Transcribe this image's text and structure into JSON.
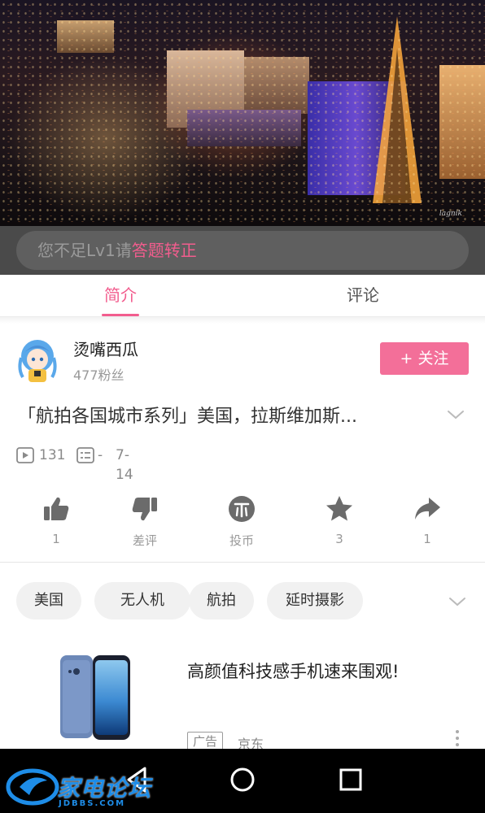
{
  "video": {
    "signature": "lagnik"
  },
  "danmaku": {
    "prefix": "您不足Lv1请",
    "link": "答题转正"
  },
  "tabs": [
    {
      "label": "简介",
      "active": true
    },
    {
      "label": "评论",
      "active": false
    }
  ],
  "uploader": {
    "name": "烫嘴西瓜",
    "fans": "477粉丝",
    "follow_label": "+ 关注"
  },
  "video_info": {
    "title": "「航拍各国城市系列」美国，拉斯维加斯...",
    "views": "131",
    "danmaku_count": "-",
    "date": "7-14"
  },
  "actions": [
    {
      "icon": "thumbs-up-icon",
      "label": "1"
    },
    {
      "icon": "thumbs-down-icon",
      "label": "差评"
    },
    {
      "icon": "coin-icon",
      "label": "投币"
    },
    {
      "icon": "star-icon",
      "label": "3"
    },
    {
      "icon": "share-icon",
      "label": "1"
    }
  ],
  "tags": [
    "美国",
    "无人机",
    "航拍",
    "延时摄影"
  ],
  "ad": {
    "title": "高颜值科技感手机速来围观!",
    "badge": "广告",
    "source": "京东"
  },
  "watermark": {
    "text": "家电论坛",
    "sub": "JDBBS.COM"
  },
  "colors": {
    "accent": "#f25d8e",
    "follow_bg": "#f36f99",
    "muted": "#999999"
  }
}
